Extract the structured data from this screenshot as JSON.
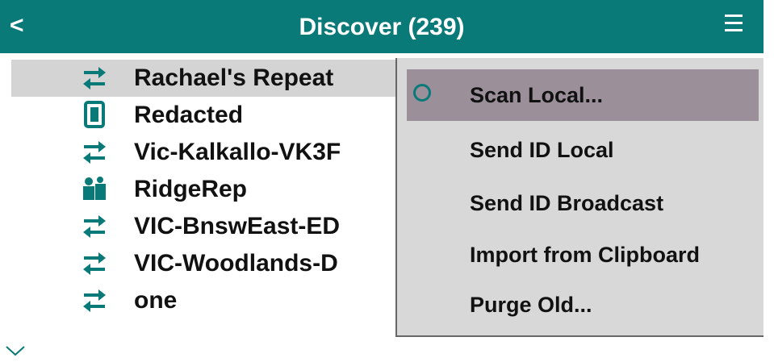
{
  "header": {
    "back_label": "<",
    "title": "Discover (239)"
  },
  "list": [
    {
      "name": "Rachael's Repeat",
      "icon": "repeater-arrows-icon"
    },
    {
      "name": "Redacted",
      "icon": "handheld-device-icon"
    },
    {
      "name": "Vic-Kalkallo-VK3F",
      "icon": "repeater-arrows-icon"
    },
    {
      "name": "RidgeRep",
      "icon": "room-server-icon"
    },
    {
      "name": "VIC-BnswEast-ED",
      "icon": "repeater-arrows-icon"
    },
    {
      "name": "VIC-Woodlands-D",
      "icon": "repeater-arrows-icon"
    },
    {
      "name": "one",
      "icon": "repeater-arrows-icon"
    }
  ],
  "menu": [
    {
      "label": "Scan Local...",
      "selected": true
    },
    {
      "label": "Send ID Local"
    },
    {
      "label": "Send ID Broadcast"
    },
    {
      "label": "Import from Clipboard"
    },
    {
      "label": "Purge Old..."
    }
  ],
  "colors": {
    "accent": "#0a7a78",
    "selected_row": "#d4d4d4",
    "menu_bg": "#d8d8d8",
    "menu_highlight": "#9b8f9a"
  }
}
